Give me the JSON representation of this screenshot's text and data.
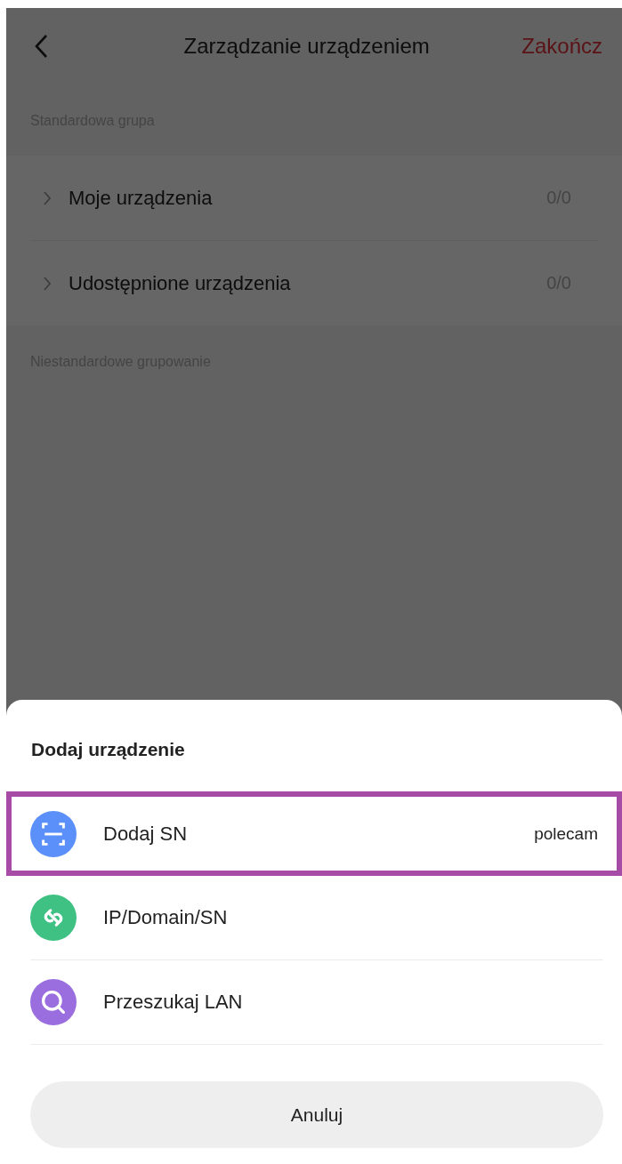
{
  "header": {
    "title": "Zarządzanie urządzeniem",
    "action": "Zakończ"
  },
  "sections": [
    {
      "label": "Standardowa grupa",
      "groups": [
        {
          "name": "Moje urządzenia",
          "count": "0/0",
          "expanded": false
        },
        {
          "name": "Udostępnione urządzenia",
          "count": "0/0",
          "expanded": false
        }
      ]
    },
    {
      "label": "Niestandardowe grupowanie"
    }
  ],
  "sheet": {
    "title": "Dodaj urządzenie",
    "options": [
      {
        "kind": "scan",
        "label": "Dodaj SN",
        "badge": "polecam",
        "color": "#5b8ff9",
        "highlighted": true
      },
      {
        "kind": "link",
        "label": "IP/Domain/SN",
        "color": "#3fc184",
        "highlighted": false
      },
      {
        "kind": "search",
        "label": "Przeszukaj LAN",
        "color": "#9b6ee0",
        "highlighted": false
      }
    ],
    "cancel": "Anuluj"
  }
}
